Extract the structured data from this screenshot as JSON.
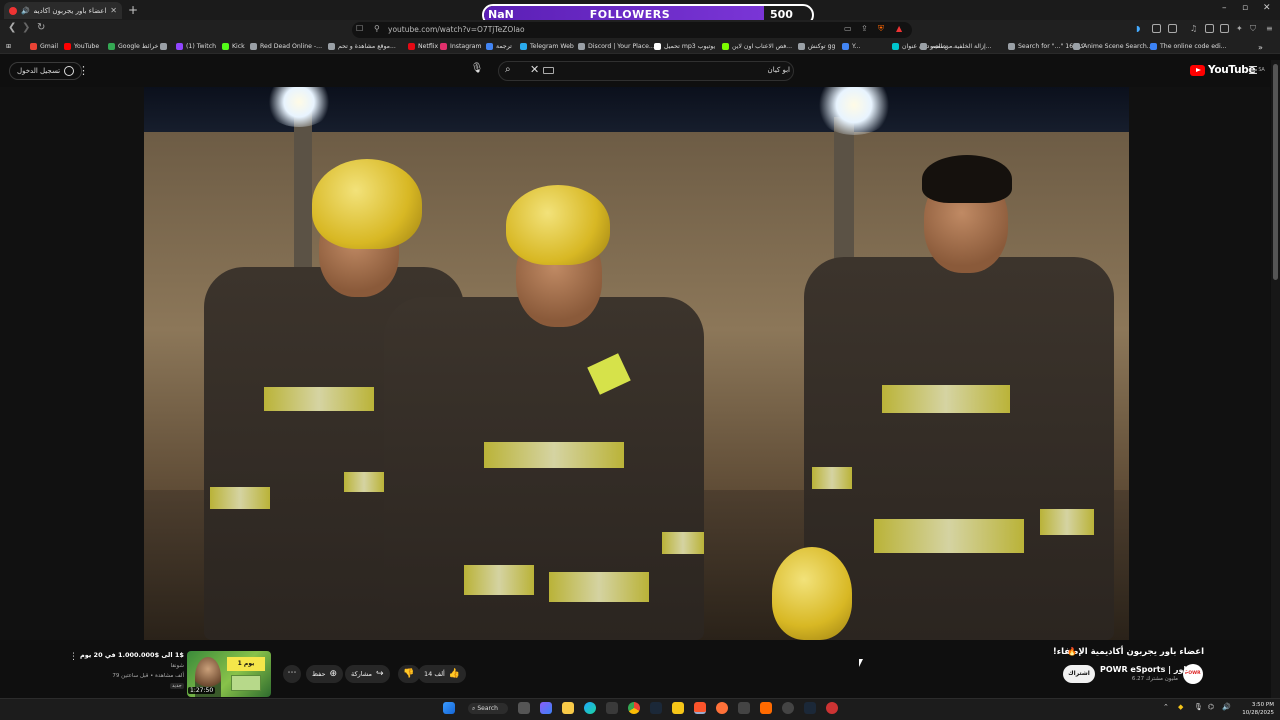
{
  "browser": {
    "tab_title": "اعضاء باور يجربون أكاديمية الإطـ",
    "url": "youtube.com/watch?v=O7TjTeZOlao",
    "bookmarks": [
      {
        "label": "Gmail",
        "color": "#ea4335"
      },
      {
        "label": "YouTube",
        "color": "#ff0000"
      },
      {
        "label": "Google خرائط",
        "color": "#34a853"
      },
      {
        "label": "",
        "color": "#9aa0a6"
      },
      {
        "label": "(1) Twitch",
        "color": "#9146ff"
      },
      {
        "label": "Kick",
        "color": "#53fc18"
      },
      {
        "label": "Red Dead Online -...",
        "color": "#9aa0a6"
      },
      {
        "label": "موقع مشاهدة و تحم...",
        "color": "#9aa0a6"
      },
      {
        "label": "Netflix",
        "color": "#e50914"
      },
      {
        "label": "Instagram",
        "color": "#e1306c"
      },
      {
        "label": "ترجمة",
        "color": "#4285f4"
      },
      {
        "label": "Telegram Web",
        "color": "#2aabee"
      },
      {
        "label": "Discord | Your Place...",
        "color": "#9aa0a6"
      },
      {
        "label": "تحميل mp3 يوتيوب",
        "color": "#ffffff"
      },
      {
        "label": "فص الاعتاب اون لاين...",
        "color": "#7cfc00"
      },
      {
        "label": "توكنش gg",
        "color": "#9aa0a6"
      },
      {
        "label": "Y...",
        "color": "#4285f4"
      },
      {
        "label": "تصميم دون عنوان -...",
        "color": "#00c4cc"
      },
      {
        "label": "إزالة الخلفية من الصو...",
        "color": "#9aa0a6"
      },
      {
        "label": "Search for \"...\" 16 كود",
        "color": "#9aa0a6"
      },
      {
        "label": "Anime Scene Search...",
        "color": "#9aa0a6"
      },
      {
        "label": "The online code edi...",
        "color": "#3b82f6"
      }
    ]
  },
  "overlay": {
    "left_value": "NaN",
    "title": "FOLLOWERS",
    "goal": "500"
  },
  "youtube": {
    "signin_label": "تسجيل الدخول",
    "search_query": "ابو كيان",
    "logo_text": "YouTube",
    "logo_region": "SA",
    "video": {
      "title": "اعضاء باور يجربون أكاديمية الإطفاء!",
      "channel": "POWR eSports | باور",
      "subscribers": "6.27 مليون مشترك",
      "subscribe_label": "اشتراك",
      "likes": "14 ألف",
      "share_label": "مشاركة",
      "save_label": "حفظ"
    },
    "recommended": {
      "title": "جربت $1 الى $1.000.000 في 20 يوم !!",
      "channel": "شونقا",
      "meta": "79 ألف مشاهدة • قبل ساعتين",
      "badge": "جديد",
      "duration": "1:27:50",
      "thumb_text": "يوم 1"
    }
  },
  "taskbar": {
    "search_label": "Search",
    "time": "3:50 PM",
    "date": "10/28/2025"
  }
}
